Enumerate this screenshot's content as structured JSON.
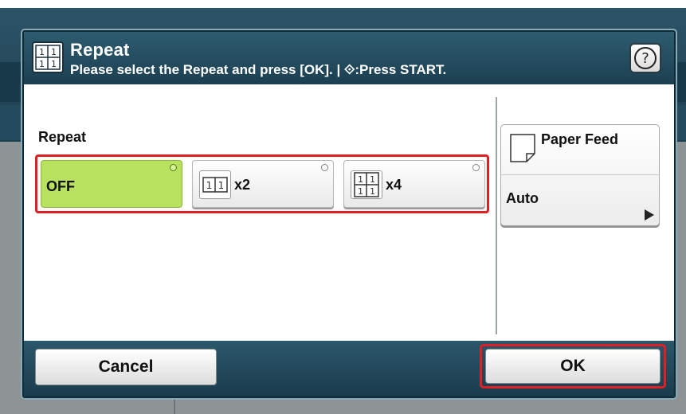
{
  "dialog": {
    "title": "Repeat",
    "subtitle": "Please select the Repeat and press [OK]. | ⟐:Press START.",
    "title_icon": "repeat-icon",
    "help_icon": "help-icon"
  },
  "repeat": {
    "label": "Repeat",
    "options": [
      {
        "label": "OFF",
        "selected": true,
        "icon": null
      },
      {
        "label": "x2",
        "selected": false,
        "icon": "repeat-x2-icon"
      },
      {
        "label": "x4",
        "selected": false,
        "icon": "repeat-x4-icon"
      }
    ]
  },
  "paper_feed": {
    "title": "Paper Feed",
    "value": "Auto",
    "icon": "paper-icon"
  },
  "footer": {
    "cancel_label": "Cancel",
    "ok_label": "OK"
  },
  "colors": {
    "title_bar": "#1b3f51",
    "selected_option": "#b9e160",
    "highlight_frame": "#e01f24"
  }
}
